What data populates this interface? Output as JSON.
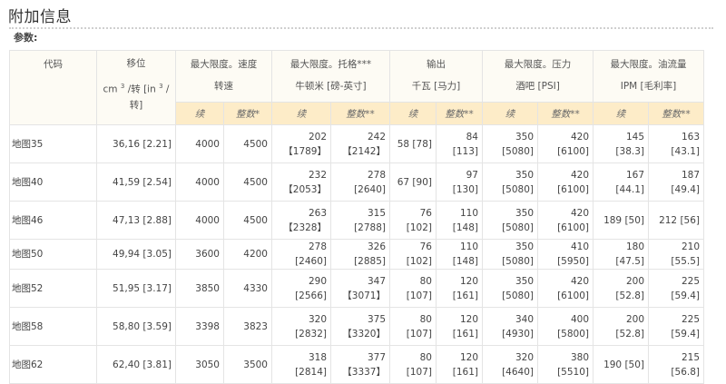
{
  "page": {
    "title": "附加信息",
    "subtitle": "参数:"
  },
  "table": {
    "headers": {
      "code": "代码",
      "displacement": {
        "line1": "移位",
        "line2a": "cm",
        "sup1": "3",
        "line2b": "/转 [in",
        "sup2": "3",
        "line2c": "/",
        "line3": "转]"
      },
      "speed": {
        "line1": "最大限度。速度",
        "line2": "转速"
      },
      "torque": {
        "line1": "最大限度。托格***",
        "line2": "牛顿米 [磅-英寸]"
      },
      "output": {
        "line1": "输出",
        "line2": "千瓦 [马力]"
      },
      "pressure": {
        "line1": "最大限度。压力",
        "line2": "酒吧 [PSI]"
      },
      "flow": {
        "line1": "最大限度。油流量",
        "line2": "IPM [毛利率]"
      }
    },
    "subheaders": {
      "cont": "续",
      "int_single": "整数*",
      "int_double": "整数**"
    },
    "rows": [
      {
        "name": "地图35",
        "disp": "36,16 [2.21]",
        "speed_c": "4000",
        "speed_i": "4500",
        "tq_c": "202\n【1789】",
        "tq_i": "242\n【2142】",
        "out_c": "58 [78]",
        "out_i": "84 [113]",
        "pr_c": "350 [5080]",
        "pr_i": "420 [6100]",
        "fl_c": "145 [38.3]",
        "fl_i": "163 [43.1]"
      },
      {
        "name": "地图40",
        "disp": "41,59 [2.54]",
        "speed_c": "4000",
        "speed_i": "4500",
        "tq_c": "232\n【2053】",
        "tq_i": "278 [2640]",
        "out_c": "67 [90]",
        "out_i": "97 [130]",
        "pr_c": "350 [5080]",
        "pr_i": "420 [6100]",
        "fl_c": "167 [44.1]",
        "fl_i": "187 [49.4]"
      },
      {
        "name": "地图46",
        "disp": "47,13 [2.88]",
        "speed_c": "4000",
        "speed_i": "4500",
        "tq_c": "263\n【2328】",
        "tq_i": "315 [2788]",
        "out_c": "76 [102]",
        "out_i": "110 [148]",
        "pr_c": "350 [5080]",
        "pr_i": "420 [6100]",
        "fl_c": "189 [50]",
        "fl_i": "212 [56]"
      },
      {
        "name": "地图50",
        "disp": "49,94 [3.05]",
        "speed_c": "3600",
        "speed_i": "4200",
        "tq_c": "278 [2460]",
        "tq_i": "326 [2885]",
        "out_c": "76 [102]",
        "out_i": "110 [148]",
        "pr_c": "350 [5080]",
        "pr_i": "410 [5950]",
        "fl_c": "180 [47.5]",
        "fl_i": "210 [55.5]"
      },
      {
        "name": "地图52",
        "disp": "51,95 [3.17]",
        "speed_c": "3850",
        "speed_i": "4330",
        "tq_c": "290 [2566]",
        "tq_i": "347\n【3071】",
        "out_c": "80 [107]",
        "out_i": "120 [161]",
        "pr_c": "350 [5080]",
        "pr_i": "420 [6100]",
        "fl_c": "200 [52.8]",
        "fl_i": "225 [59.4]"
      },
      {
        "name": "地图58",
        "disp": "58,80 [3.59]",
        "speed_c": "3398",
        "speed_i": "3823",
        "tq_c": "320 [2832]",
        "tq_i": "375\n【3320】",
        "out_c": "80 [107]",
        "out_i": "120 [161]",
        "pr_c": "340 [4930]",
        "pr_i": "400 [5800]",
        "fl_c": "200 [52.8]",
        "fl_i": "225 [59.4]"
      },
      {
        "name": "地图62",
        "disp": "62,40 [3.81]",
        "speed_c": "3050",
        "speed_i": "3500",
        "tq_c": "318 [2814]",
        "tq_i": "377\n【3337】",
        "out_c": "80 [107]",
        "out_i": "120 [161]",
        "pr_c": "320 [4640]",
        "pr_i": "380 [5510]",
        "fl_c": "190 [50]",
        "fl_i": "215 [56.8]"
      }
    ]
  }
}
